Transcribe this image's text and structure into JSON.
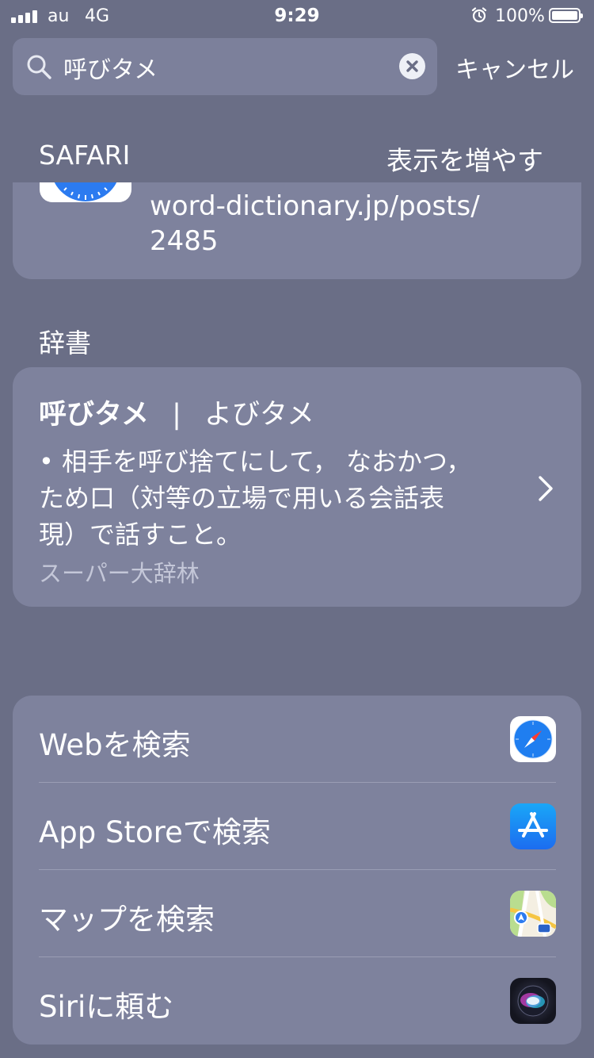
{
  "status_bar": {
    "carrier": "au",
    "network": "4G",
    "time": "9:29",
    "battery": "100%",
    "icons": [
      "signal-bars-icon",
      "alarm-icon",
      "battery-icon"
    ]
  },
  "search": {
    "query": "呼びタメ",
    "cancel_label": "キャンセル",
    "icons": [
      "search-icon",
      "clear-icon"
    ]
  },
  "safari": {
    "header": "SAFARI",
    "more_label": "表示を増やす",
    "url_line1": "word-dictionary.jp/posts/",
    "url_line2": "2485",
    "icon": "safari-icon"
  },
  "dictionary": {
    "header": "辞書",
    "word": "呼びタメ",
    "separator": "|",
    "reading": "よびタメ",
    "definition_line1": "• 相手を呼び捨てにして，  なおかつ，",
    "definition_line2": "ため口（対等の立場で用いる会話表",
    "definition_line3": "現）で話すこと。",
    "source": "スーパー大辞林",
    "icon": "chevron-right-icon"
  },
  "actions": [
    {
      "label": "Webを検索",
      "icon": "safari-icon"
    },
    {
      "label": "App Storeで検索",
      "icon": "app-store-icon"
    },
    {
      "label": "マップを検索",
      "icon": "maps-icon"
    },
    {
      "label": "Siriに頼む",
      "icon": "siri-icon"
    }
  ],
  "colors": {
    "background": "#6a6e86",
    "card": "#7e829d",
    "search_field": "#7c809b",
    "text": "#ffffff",
    "secondary_text": "#c4c7d8"
  }
}
